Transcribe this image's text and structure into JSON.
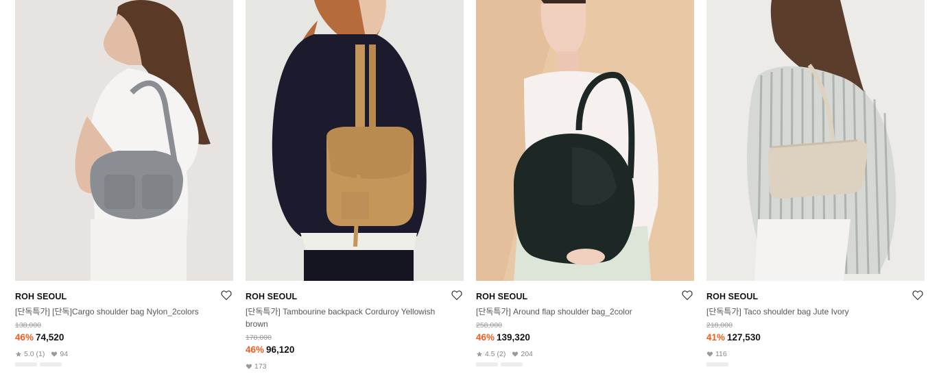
{
  "products": [
    {
      "brand": "ROH SEOUL",
      "name": "[단독특가] [단독]Cargo shoulder bag Nylon_2colors",
      "original_price": "138,000",
      "discount": "46%",
      "price": "74,520",
      "rating": "5.0",
      "review_count": "(1)",
      "likes": "94",
      "image": "model with grey nylon cargo shoulder bag",
      "bg": "#e9e7e4",
      "accent": "#8a8d92"
    },
    {
      "brand": "ROH SEOUL",
      "name": "[단독특가] Tambourine backpack Corduroy Yellowish brown",
      "original_price": "178,000",
      "discount": "46%",
      "price": "96,120",
      "rating": "",
      "review_count": "",
      "likes": "173",
      "image": "model with yellowish brown corduroy backpack",
      "bg": "#e6e6e3",
      "accent": "#c4965a"
    },
    {
      "brand": "ROH SEOUL",
      "name": "[단독특가] Around flap shoulder bag_2color",
      "original_price": "258,000",
      "discount": "46%",
      "price": "139,320",
      "rating": "4.5",
      "review_count": "(2)",
      "likes": "204",
      "image": "model with dark green leather flap shoulder bag",
      "bg": "#e9c8a6",
      "accent": "#1d2826"
    },
    {
      "brand": "ROH SEOUL",
      "name": "[단독특가] Taco shoulder bag Jute Ivory",
      "original_price": "218,000",
      "discount": "41%",
      "price": "127,530",
      "rating": "",
      "review_count": "",
      "likes": "116",
      "image": "model with ivory jute shoulder bag",
      "bg": "#ecebe8",
      "accent": "#ddd2bf"
    }
  ],
  "colors": {
    "discount": "#f25c19",
    "icon": "#999999"
  }
}
